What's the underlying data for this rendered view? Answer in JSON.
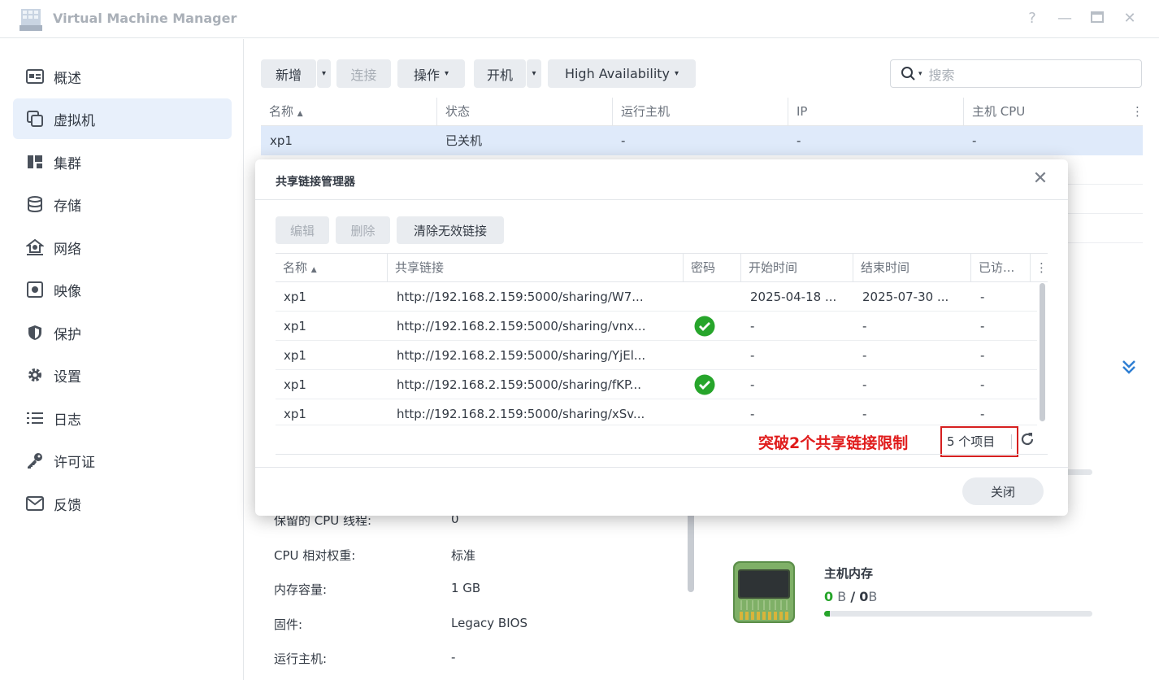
{
  "window": {
    "title": "Virtual Machine Manager"
  },
  "sidebar": {
    "items": [
      {
        "label": "概述",
        "icon": "overview-icon"
      },
      {
        "label": "虚拟机",
        "icon": "vm-icon",
        "active": true
      },
      {
        "label": "集群",
        "icon": "cluster-icon"
      },
      {
        "label": "存储",
        "icon": "storage-icon"
      },
      {
        "label": "网络",
        "icon": "network-icon"
      },
      {
        "label": "映像",
        "icon": "image-icon"
      },
      {
        "label": "保护",
        "icon": "protection-icon"
      },
      {
        "label": "设置",
        "icon": "settings-icon"
      },
      {
        "label": "日志",
        "icon": "log-icon"
      },
      {
        "label": "许可证",
        "icon": "license-icon"
      },
      {
        "label": "反馈",
        "icon": "feedback-icon"
      }
    ]
  },
  "toolbar": {
    "add": "新增",
    "connect": "连接",
    "action": "操作",
    "power_on": "开机",
    "ha": "High Availability",
    "search_placeholder": "搜索"
  },
  "grid": {
    "columns": [
      "名称",
      "状态",
      "运行主机",
      "IP",
      "主机 CPU"
    ],
    "rows": [
      {
        "name": "xp1",
        "status": "已关机",
        "host": "-",
        "ip": "-",
        "cpu": "-"
      }
    ]
  },
  "details": [
    {
      "label": "保留的 CPU 线程:",
      "value": "0"
    },
    {
      "label": "CPU 相对权重:",
      "value": "标准"
    },
    {
      "label": "内存容量:",
      "value": "1 GB"
    },
    {
      "label": "固件:",
      "value": "Legacy BIOS"
    },
    {
      "label": "运行主机:",
      "value": "-"
    }
  ],
  "memory": {
    "title": "主机内存",
    "used": "0",
    "used_unit": "B",
    "sep": "/",
    "total": "0",
    "total_unit": "B",
    "fraction": 0.02
  },
  "modal": {
    "title": "共享链接管理器",
    "buttons": {
      "edit": "编辑",
      "delete": "删除",
      "clear": "清除无效链接"
    },
    "columns": [
      "名称",
      "共享链接",
      "密码",
      "开始时间",
      "结束时间",
      "已访..."
    ],
    "rows": [
      {
        "name": "xp1",
        "link": "http://192.168.2.159:5000/sharing/W7...",
        "password": false,
        "start": "2025-04-18 ...",
        "end": "2025-07-30 ...",
        "visits": "-"
      },
      {
        "name": "xp1",
        "link": "http://192.168.2.159:5000/sharing/vnx...",
        "password": true,
        "start": "-",
        "end": "-",
        "visits": "-"
      },
      {
        "name": "xp1",
        "link": "http://192.168.2.159:5000/sharing/YjEl...",
        "password": false,
        "start": "-",
        "end": "-",
        "visits": "-"
      },
      {
        "name": "xp1",
        "link": "http://192.168.2.159:5000/sharing/fKP...",
        "password": true,
        "start": "-",
        "end": "-",
        "visits": "-"
      },
      {
        "name": "xp1",
        "link": "http://192.168.2.159:5000/sharing/xSv...",
        "password": false,
        "start": "-",
        "end": "-",
        "visits": "-"
      }
    ],
    "annotation": "突破2个共享链接限制",
    "item_count": "5 个项目",
    "close": "关闭"
  },
  "colors": {
    "accent": "#2f7fd3",
    "selected_row": "#dfeafa",
    "annotation": "#e01b1b",
    "check": "#27a52b"
  }
}
